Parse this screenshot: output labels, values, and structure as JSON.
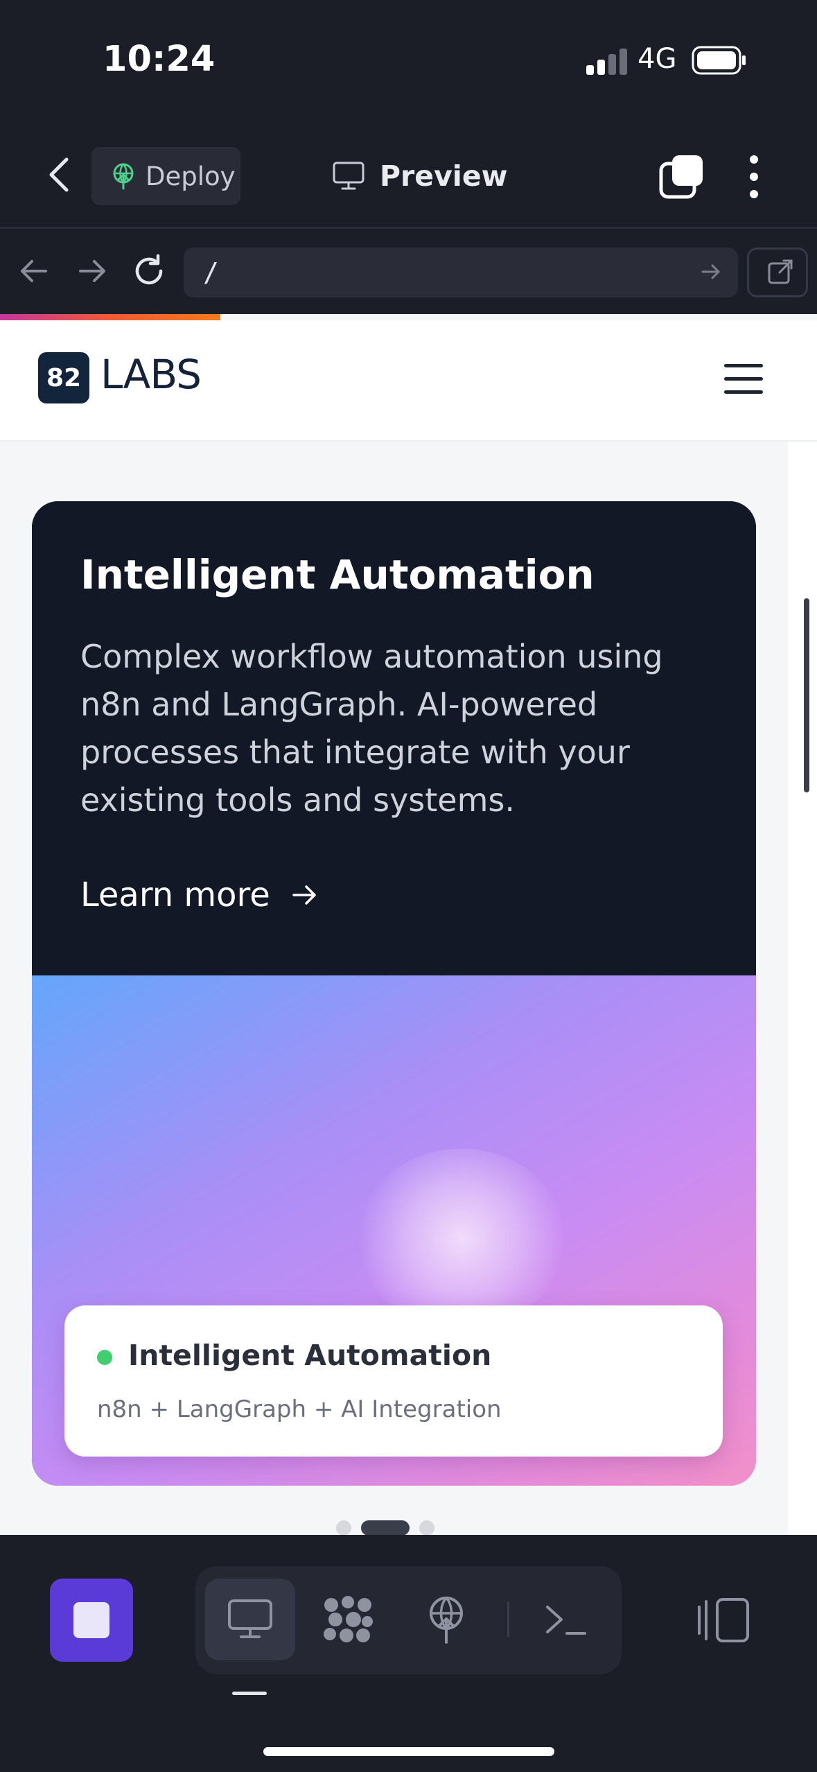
{
  "status_bar": {
    "time": "10:24",
    "network": "4G",
    "icons": [
      "signal-icon",
      "battery-icon"
    ]
  },
  "top_bar": {
    "deploy_label": "Deploy",
    "preview_label": "Preview",
    "icons": [
      "chevron-left-icon",
      "deploy-icon",
      "monitor-icon",
      "tabs-icon",
      "more-vertical-icon"
    ]
  },
  "url_bar": {
    "path": "/",
    "icons": [
      "arrow-left-icon",
      "arrow-right-icon",
      "reload-icon",
      "go-arrow-icon",
      "external-link-icon"
    ]
  },
  "site": {
    "logo_number": "82",
    "logo_text": "LABS",
    "progress_fraction": 0.27,
    "card": {
      "title": "Intelligent Automation",
      "description": "Complex workflow automation using n8n and LangGraph. AI-powered processes that integrate with your existing tools and systems.",
      "cta": "Learn more",
      "badge_title": "Intelligent Automation",
      "badge_subtitle": "n8n + LangGraph + AI Integration",
      "status_color": "#3fcf6e"
    },
    "carousel": {
      "count": 3,
      "active_index": 1
    }
  },
  "bottom_bar": {
    "tabs": [
      "monitor-icon",
      "apps-grid-icon",
      "deploy-icon",
      "terminal-icon"
    ],
    "active_tab": 0,
    "accent": "#5b3bd7"
  }
}
